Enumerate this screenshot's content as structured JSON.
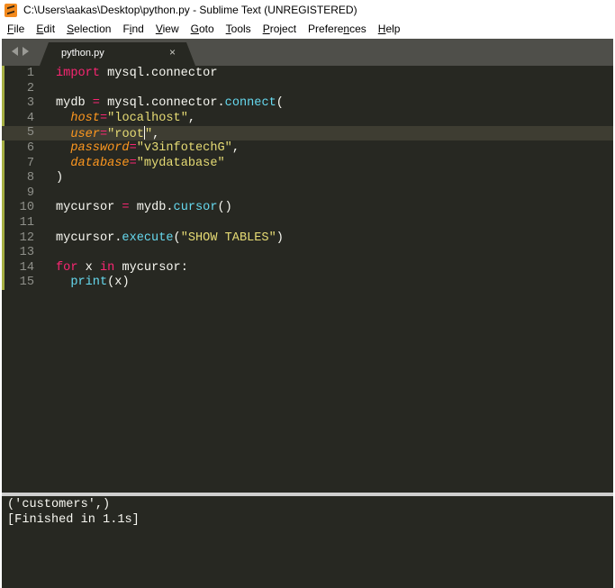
{
  "window": {
    "title": "C:\\Users\\aakas\\Desktop\\python.py - Sublime Text (UNREGISTERED)",
    "icon": "sublime-text-icon"
  },
  "menu": {
    "items": [
      {
        "label": "File",
        "ul": "F",
        "rest": "ile"
      },
      {
        "label": "Edit",
        "ul": "E",
        "rest": "dit"
      },
      {
        "label": "Selection",
        "ul": "S",
        "rest": "election"
      },
      {
        "label": "Find",
        "pre": "F",
        "ul": "i",
        "rest": "nd"
      },
      {
        "label": "View",
        "ul": "V",
        "rest": "iew"
      },
      {
        "label": "Goto",
        "ul": "G",
        "rest": "oto"
      },
      {
        "label": "Tools",
        "ul": "T",
        "rest": "ools"
      },
      {
        "label": "Project",
        "ul": "P",
        "rest": "roject"
      },
      {
        "label": "Preferences",
        "pre": "Prefere",
        "ul": "n",
        "rest": "ces"
      },
      {
        "label": "Help",
        "ul": "H",
        "rest": "elp"
      }
    ]
  },
  "tabs": {
    "active": {
      "label": "python.py",
      "close": "×"
    }
  },
  "editor": {
    "lines": [
      {
        "n": "1",
        "tokens": [
          [
            "kw",
            "import"
          ],
          [
            "plain",
            " mysql.connector"
          ]
        ]
      },
      {
        "n": "2",
        "tokens": []
      },
      {
        "n": "3",
        "tokens": [
          [
            "plain",
            "mydb "
          ],
          [
            "op",
            "="
          ],
          [
            "plain",
            " mysql.connector."
          ],
          [
            "fn",
            "connect"
          ],
          [
            "plain",
            "("
          ]
        ]
      },
      {
        "n": "4",
        "tokens": [
          [
            "plain",
            "  "
          ],
          [
            "param",
            "host"
          ],
          [
            "op",
            "="
          ],
          [
            "str",
            "\"localhost\""
          ],
          [
            "plain",
            ","
          ]
        ]
      },
      {
        "n": "5",
        "tokens": [
          [
            "plain",
            "  "
          ],
          [
            "param",
            "user"
          ],
          [
            "op",
            "="
          ],
          [
            "str",
            "\"root"
          ],
          [
            "cursor",
            ""
          ],
          [
            "str",
            "\""
          ],
          [
            "plain",
            ","
          ]
        ],
        "highlight": true
      },
      {
        "n": "6",
        "tokens": [
          [
            "plain",
            "  "
          ],
          [
            "param",
            "password"
          ],
          [
            "op",
            "="
          ],
          [
            "str",
            "\"v3infotechG\""
          ],
          [
            "plain",
            ","
          ]
        ]
      },
      {
        "n": "7",
        "tokens": [
          [
            "plain",
            "  "
          ],
          [
            "param",
            "database"
          ],
          [
            "op",
            "="
          ],
          [
            "str",
            "\"mydatabase\""
          ]
        ]
      },
      {
        "n": "8",
        "tokens": [
          [
            "plain",
            ")"
          ]
        ]
      },
      {
        "n": "9",
        "tokens": []
      },
      {
        "n": "10",
        "tokens": [
          [
            "plain",
            "mycursor "
          ],
          [
            "op",
            "="
          ],
          [
            "plain",
            " mydb."
          ],
          [
            "fn",
            "cursor"
          ],
          [
            "plain",
            "()"
          ]
        ]
      },
      {
        "n": "11",
        "tokens": []
      },
      {
        "n": "12",
        "tokens": [
          [
            "plain",
            "mycursor."
          ],
          [
            "fn",
            "execute"
          ],
          [
            "plain",
            "("
          ],
          [
            "str",
            "\"SHOW TABLES\""
          ],
          [
            "plain",
            ")"
          ]
        ]
      },
      {
        "n": "13",
        "tokens": []
      },
      {
        "n": "14",
        "tokens": [
          [
            "kw",
            "for"
          ],
          [
            "plain",
            " x "
          ],
          [
            "kw",
            "in"
          ],
          [
            "plain",
            " mycursor:"
          ]
        ]
      },
      {
        "n": "15",
        "tokens": [
          [
            "plain",
            "  "
          ],
          [
            "fn",
            "print"
          ],
          [
            "plain",
            "(x)"
          ]
        ]
      }
    ]
  },
  "output": {
    "lines": [
      "('customers',)",
      "[Finished in 1.1s]"
    ]
  },
  "colors": {
    "background": "#272822",
    "keyword": "#f92672",
    "function": "#66d9ef",
    "string": "#e6db74",
    "parameter": "#fd971f",
    "text": "#f8f8f2",
    "line_number": "#8f908a"
  }
}
